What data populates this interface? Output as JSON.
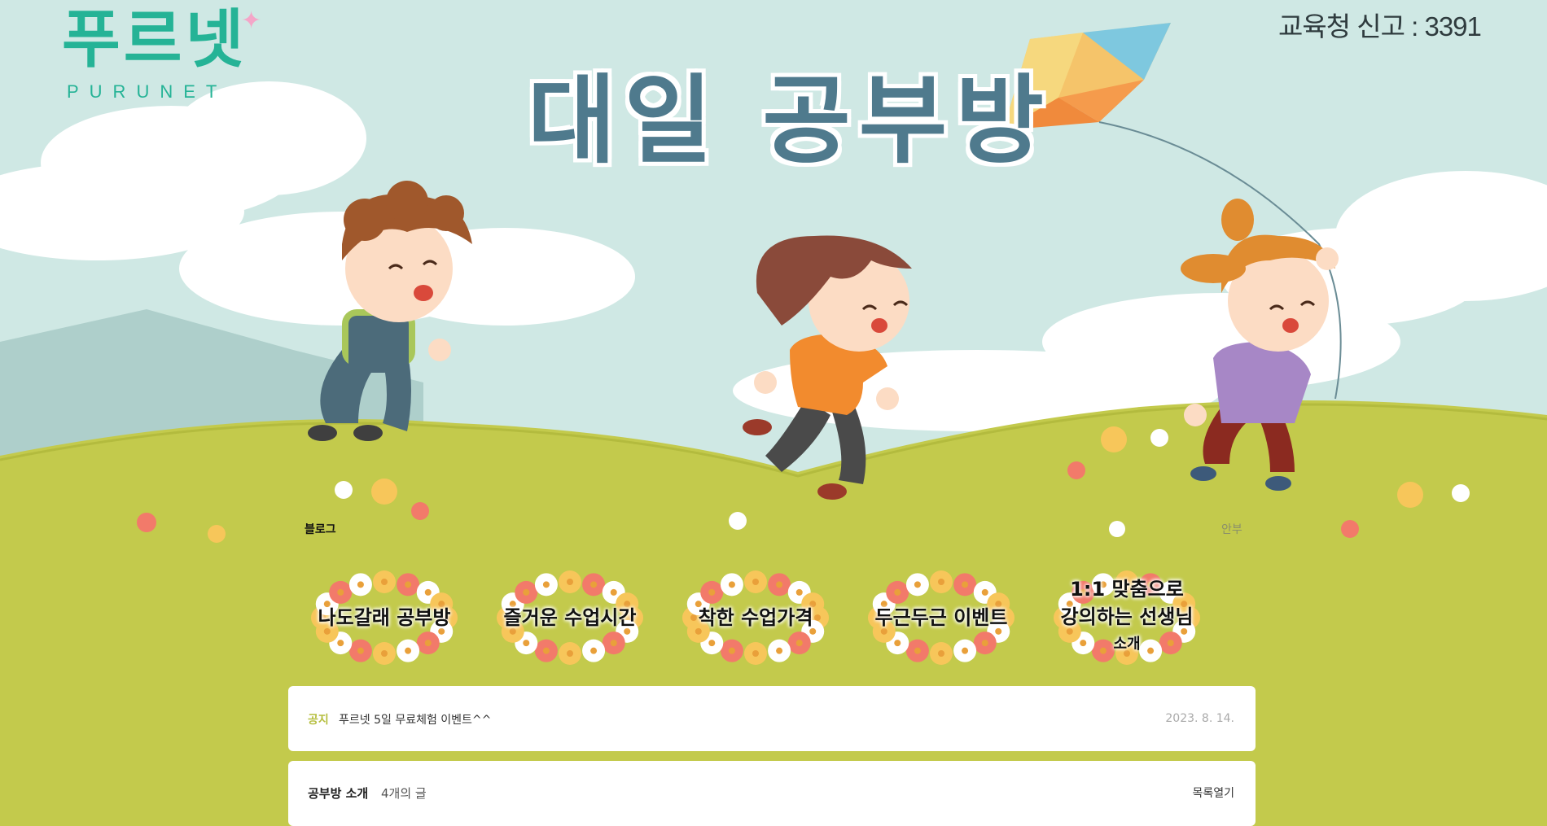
{
  "brand": {
    "logo_text": "푸르넷",
    "logo_sub": "PURUNET"
  },
  "registration_text": "교육청 신고 : 3391",
  "page_title": "대일 공부방",
  "nav": {
    "blog_label": "블로그",
    "guide_label": "안부"
  },
  "menu": [
    {
      "lines": [
        "나도갈래 공부방"
      ]
    },
    {
      "lines": [
        "즐거운 수업시간"
      ]
    },
    {
      "lines": [
        "착한 수업가격"
      ]
    },
    {
      "lines": [
        "두근두근 이벤트"
      ]
    },
    {
      "lines": [
        "1:1 맞춤으로",
        "강의하는 선생님",
        "소개"
      ]
    }
  ],
  "notice": {
    "tag": "공지",
    "title": "푸르넷 5일 무료체험 이벤트^^",
    "date": "2023. 8. 14."
  },
  "board": {
    "title": "공부방 소개",
    "count": "4개의 글",
    "toggle_label": "목록열기"
  },
  "colors": {
    "sky": "#cfe8e4",
    "grass": "#c3ca4c",
    "brand_green": "#25b396",
    "title_blue": "#4f7a8d"
  }
}
